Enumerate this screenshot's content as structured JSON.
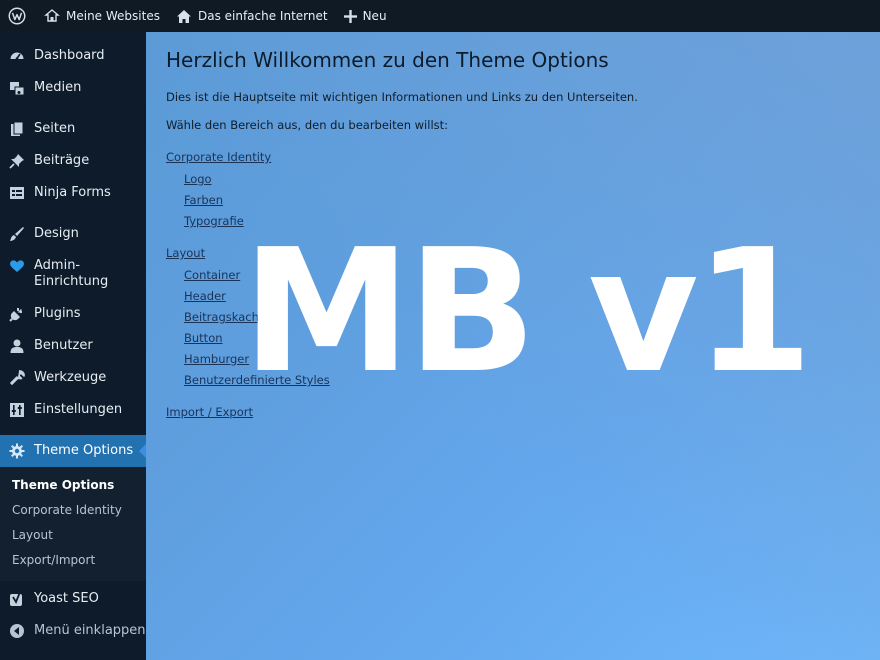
{
  "adminbar": {
    "items": [
      {
        "label": "Meine Websites",
        "icon": "sites-icon"
      },
      {
        "label": "Das einfache Internet",
        "icon": "home-icon"
      },
      {
        "label": "Neu",
        "icon": "plus-icon"
      }
    ]
  },
  "sidebar": {
    "items": [
      {
        "label": "Dashboard",
        "icon": "dashboard-icon"
      },
      {
        "label": "Medien",
        "icon": "media-icon"
      },
      {
        "label": "Seiten",
        "icon": "pages-icon"
      },
      {
        "label": "Beiträge",
        "icon": "pin-icon"
      },
      {
        "label": "Ninja Forms",
        "icon": "forms-icon"
      },
      {
        "label": "Design",
        "icon": "brush-icon"
      },
      {
        "label": "Admin-\nEinrichtung",
        "icon": "heart-icon"
      },
      {
        "label": "Plugins",
        "icon": "plugin-icon"
      },
      {
        "label": "Benutzer",
        "icon": "user-icon"
      },
      {
        "label": "Werkzeuge",
        "icon": "wrench-icon"
      },
      {
        "label": "Einstellungen",
        "icon": "settings-icon"
      },
      {
        "label": "Theme Options",
        "icon": "gear-icon"
      }
    ],
    "submenu": [
      {
        "label": "Theme Options"
      },
      {
        "label": "Corporate Identity"
      },
      {
        "label": "Layout"
      },
      {
        "label": "Export/Import"
      }
    ],
    "after": [
      {
        "label": "Yoast SEO",
        "icon": "yoast-icon"
      },
      {
        "label": "Menü einklappen",
        "icon": "collapse-icon"
      }
    ]
  },
  "main": {
    "title": "Herzlich Willkommen zu den Theme Options",
    "intro": "Dies ist die Hauptseite mit wichtigen Informationen und Links zu den Unterseiten.",
    "instruction": "Wähle den Bereich aus, den du bearbeiten willst:",
    "sections": [
      {
        "label": "Corporate Identity",
        "links": [
          "Logo",
          "Farben",
          "Typografie"
        ]
      },
      {
        "label": "Layout",
        "links": [
          "Container",
          "Header",
          "Beitragskacheln",
          "Button",
          "Hamburger",
          "Benutzerdefinierte Styles"
        ]
      },
      {
        "label": "Import / Export",
        "links": []
      }
    ]
  },
  "watermark": "MB v1"
}
